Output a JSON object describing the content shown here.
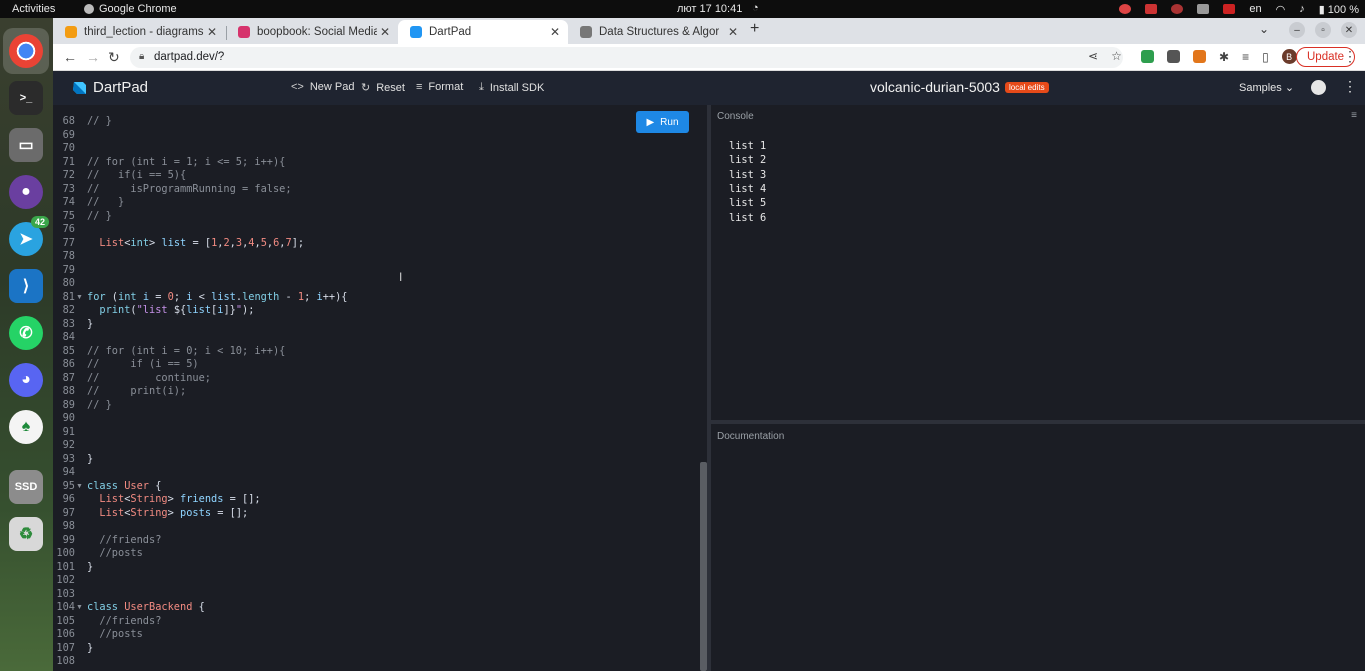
{
  "system_bar": {
    "activities": "Activities",
    "app_name": "Google Chrome",
    "clock": "лют 17  10:41",
    "lang": "en",
    "battery": "100 %"
  },
  "dock": {
    "telegram_badge": "42"
  },
  "browser": {
    "tabs": [
      {
        "title": "third_lection - diagrams.n",
        "favicon_color": "#f39c12"
      },
      {
        "title": "boopbook: Social Media I",
        "favicon_color": "#d6336c"
      },
      {
        "title": "DartPad",
        "favicon_color": "#2196f3"
      },
      {
        "title": "Data Structures & Algorit",
        "favicon_color": "#777777"
      }
    ],
    "url": "dartpad.dev/?",
    "update_label": "Update",
    "avatar_letter": "B"
  },
  "dartpad": {
    "title": "DartPad",
    "new_pad": "New Pad",
    "reset": "Reset",
    "format": "Format",
    "install_sdk": "Install SDK",
    "pad_name": "volcanic-durian-5003",
    "local_edits": "local edits",
    "samples": "Samples",
    "run": "Run",
    "console_label": "Console",
    "docs_label": "Documentation",
    "console_output": [
      "list 1",
      "list 2",
      "list 3",
      "list 4",
      "list 5",
      "list 6"
    ]
  },
  "code_lines": [
    {
      "n": "68",
      "f": false,
      "p": [
        [
          "c",
          "// }"
        ]
      ]
    },
    {
      "n": "69",
      "f": false,
      "p": []
    },
    {
      "n": "70",
      "f": false,
      "p": []
    },
    {
      "n": "71",
      "f": false,
      "p": [
        [
          "c",
          "// for (int i = 1; i <= 5; i++){"
        ]
      ]
    },
    {
      "n": "72",
      "f": false,
      "p": [
        [
          "c",
          "//   if(i == 5){"
        ]
      ]
    },
    {
      "n": "73",
      "f": false,
      "p": [
        [
          "c",
          "//     isProgrammRunning = false;"
        ]
      ]
    },
    {
      "n": "74",
      "f": false,
      "p": [
        [
          "c",
          "//   }"
        ]
      ]
    },
    {
      "n": "75",
      "f": false,
      "p": [
        [
          "c",
          "// }"
        ]
      ]
    },
    {
      "n": "76",
      "f": false,
      "p": []
    },
    {
      "n": "77",
      "f": false,
      "p": [
        [
          "p",
          "  "
        ],
        [
          "t",
          "List"
        ],
        [
          "p",
          "<"
        ],
        [
          "k",
          "int"
        ],
        [
          "p",
          "> "
        ],
        [
          "l",
          "list"
        ],
        [
          "p",
          " = ["
        ],
        [
          "n",
          "1"
        ],
        [
          "p",
          ","
        ],
        [
          "n",
          "2"
        ],
        [
          "p",
          ","
        ],
        [
          "n",
          "3"
        ],
        [
          "p",
          ","
        ],
        [
          "n",
          "4"
        ],
        [
          "p",
          ","
        ],
        [
          "n",
          "5"
        ],
        [
          "p",
          ","
        ],
        [
          "n",
          "6"
        ],
        [
          "p",
          ","
        ],
        [
          "n",
          "7"
        ],
        [
          "p",
          "];"
        ]
      ]
    },
    {
      "n": "78",
      "f": false,
      "p": []
    },
    {
      "n": "79",
      "f": false,
      "p": []
    },
    {
      "n": "80",
      "f": false,
      "p": []
    },
    {
      "n": "81",
      "f": true,
      "p": [
        [
          "k",
          "for"
        ],
        [
          "p",
          " ("
        ],
        [
          "k",
          "int"
        ],
        [
          "p",
          " "
        ],
        [
          "l",
          "i"
        ],
        [
          "p",
          " = "
        ],
        [
          "n",
          "0"
        ],
        [
          "p",
          "; "
        ],
        [
          "l",
          "i"
        ],
        [
          "p",
          " < "
        ],
        [
          "l",
          "list"
        ],
        [
          "p",
          "."
        ],
        [
          "f",
          "length"
        ],
        [
          "p",
          " - "
        ],
        [
          "n",
          "1"
        ],
        [
          "p",
          "; "
        ],
        [
          "l",
          "i"
        ],
        [
          "p",
          "++){"
        ]
      ]
    },
    {
      "n": "82",
      "f": false,
      "p": [
        [
          "p",
          "  "
        ],
        [
          "f",
          "print"
        ],
        [
          "p",
          "("
        ],
        [
          "s",
          "\"list "
        ],
        [
          "p",
          "${"
        ],
        [
          "l",
          "list"
        ],
        [
          "p",
          "["
        ],
        [
          "l",
          "i"
        ],
        [
          "p",
          "]}"
        ],
        [
          "s",
          "\""
        ],
        [
          "p",
          ");"
        ]
      ]
    },
    {
      "n": "83",
      "f": false,
      "p": [
        [
          "p",
          "}"
        ]
      ]
    },
    {
      "n": "84",
      "f": false,
      "p": []
    },
    {
      "n": "85",
      "f": false,
      "p": [
        [
          "c",
          "// for (int i = 0; i < 10; i++){"
        ]
      ]
    },
    {
      "n": "86",
      "f": false,
      "p": [
        [
          "c",
          "//     if (i == 5)"
        ]
      ]
    },
    {
      "n": "87",
      "f": false,
      "p": [
        [
          "c",
          "//         continue;"
        ]
      ]
    },
    {
      "n": "88",
      "f": false,
      "p": [
        [
          "c",
          "//     print(i);"
        ]
      ]
    },
    {
      "n": "89",
      "f": false,
      "p": [
        [
          "c",
          "// }"
        ]
      ]
    },
    {
      "n": "90",
      "f": false,
      "p": []
    },
    {
      "n": "91",
      "f": false,
      "p": []
    },
    {
      "n": "92",
      "f": false,
      "p": []
    },
    {
      "n": "93",
      "f": false,
      "p": [
        [
          "p",
          "}"
        ]
      ]
    },
    {
      "n": "94",
      "f": false,
      "p": []
    },
    {
      "n": "95",
      "f": true,
      "p": [
        [
          "k",
          "class"
        ],
        [
          "p",
          " "
        ],
        [
          "t",
          "User"
        ],
        [
          "p",
          " {"
        ]
      ]
    },
    {
      "n": "96",
      "f": false,
      "p": [
        [
          "p",
          "  "
        ],
        [
          "t",
          "List"
        ],
        [
          "p",
          "<"
        ],
        [
          "t",
          "String"
        ],
        [
          "p",
          "> "
        ],
        [
          "l",
          "friends"
        ],
        [
          "p",
          " = [];"
        ]
      ]
    },
    {
      "n": "97",
      "f": false,
      "p": [
        [
          "p",
          "  "
        ],
        [
          "t",
          "List"
        ],
        [
          "p",
          "<"
        ],
        [
          "t",
          "String"
        ],
        [
          "p",
          "> "
        ],
        [
          "l",
          "posts"
        ],
        [
          "p",
          " = [];"
        ]
      ]
    },
    {
      "n": "98",
      "f": false,
      "p": []
    },
    {
      "n": "99",
      "f": false,
      "p": [
        [
          "c",
          "  //friends?"
        ]
      ]
    },
    {
      "n": "100",
      "f": false,
      "p": [
        [
          "c",
          "  //posts"
        ]
      ]
    },
    {
      "n": "101",
      "f": false,
      "p": [
        [
          "p",
          "}"
        ]
      ]
    },
    {
      "n": "102",
      "f": false,
      "p": []
    },
    {
      "n": "103",
      "f": false,
      "p": []
    },
    {
      "n": "104",
      "f": true,
      "p": [
        [
          "k",
          "class"
        ],
        [
          "p",
          " "
        ],
        [
          "t",
          "UserBackend"
        ],
        [
          "p",
          " {"
        ]
      ]
    },
    {
      "n": "105",
      "f": false,
      "p": [
        [
          "c",
          "  //friends?"
        ]
      ]
    },
    {
      "n": "106",
      "f": false,
      "p": [
        [
          "c",
          "  //posts"
        ]
      ]
    },
    {
      "n": "107",
      "f": false,
      "p": [
        [
          "p",
          "}"
        ]
      ]
    },
    {
      "n": "108",
      "f": false,
      "p": []
    }
  ]
}
